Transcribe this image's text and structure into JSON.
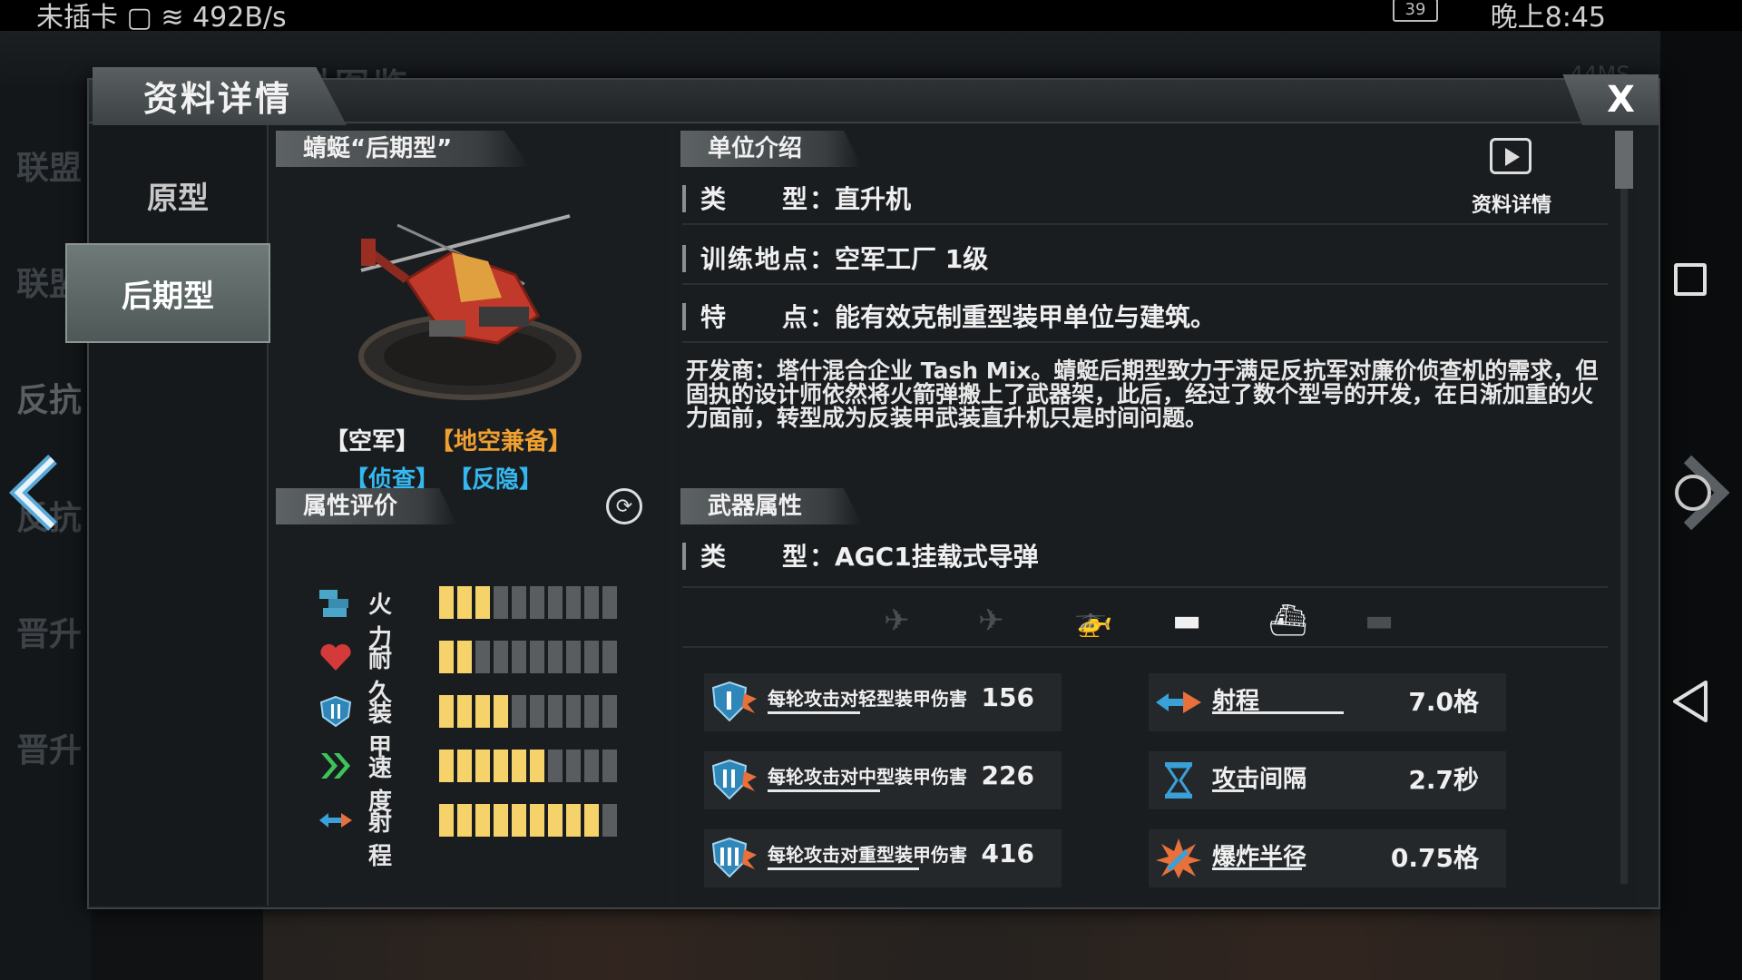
{
  "status_bar": {
    "carrier": "未插卡",
    "speed": "492B/s",
    "battery": "39",
    "time": "晚上8:45"
  },
  "background": {
    "title": "资料图鉴",
    "ping": "44MS",
    "left_items": [
      "联盟",
      "联盟",
      "反抗",
      "反抗",
      "晋升",
      "晋升"
    ]
  },
  "dialog": {
    "title": "资料详情",
    "close_label": "X",
    "variants": [
      "原型",
      "后期型"
    ],
    "active_variant": "后期型"
  },
  "unit": {
    "name": "蜻蜓“后期型”",
    "tags": [
      {
        "text": "【空军】",
        "color": "#f0f0f0"
      },
      {
        "text": "【地空兼备】",
        "color": "#f0a030"
      },
      {
        "text": "【侦查】",
        "color": "#35b8f0"
      },
      {
        "text": "【反隐】",
        "color": "#35b8f0"
      }
    ]
  },
  "attributes": {
    "header": "属性评价",
    "stats": [
      {
        "icon": "firepower-icon",
        "label": "火力",
        "level": 3,
        "max": 10
      },
      {
        "icon": "heart-icon",
        "label": "耐久",
        "level": 2,
        "max": 10
      },
      {
        "icon": "shield-icon",
        "label": "装甲",
        "level": 4,
        "max": 10
      },
      {
        "icon": "speed-chevron-icon",
        "label": "速度",
        "level": 6,
        "max": 10
      },
      {
        "icon": "range-arrow-icon",
        "label": "射程",
        "level": 9,
        "max": 10
      }
    ]
  },
  "intro": {
    "header": "单位介绍",
    "detail_label": "资料详情",
    "rows": [
      {
        "key": "类　　型：",
        "value": "直升机"
      },
      {
        "key": "训练地点：",
        "value": "空军工厂 1级"
      },
      {
        "key": "特　　点：",
        "value": "能有效克制重型装甲单位与建筑。"
      }
    ],
    "description": "开发商：塔什混合企业 Tash Mix。蜻蜓后期型致力于满足反抗军对廉价侦查机的需求，但固执的设计师依然将火箭弹搬上了武器架，此后，经过了数个型号的开发，在日渐加重的火力面前，转型成为反装甲武装直升机只是时间问题。"
  },
  "weapon": {
    "header": "武器属性",
    "type_key": "类　　型：",
    "type_value": "AGC1挂载式导弹",
    "targets": [
      {
        "icon": "fighter-jet-icon",
        "symbol": "✈",
        "active": false
      },
      {
        "icon": "bomber-icon",
        "symbol": "✈",
        "active": false
      },
      {
        "icon": "helicopter-icon",
        "symbol": "🚁",
        "active": true
      },
      {
        "icon": "tank-icon",
        "symbol": "▬",
        "active": true
      },
      {
        "icon": "ship-icon",
        "symbol": "⛴",
        "active": true
      },
      {
        "icon": "submarine-icon",
        "symbol": "▬",
        "active": false
      }
    ],
    "damage": [
      {
        "icon": "shield-one-icon",
        "label": "每轮攻击对轻型装甲伤害",
        "value": "156",
        "fill": 0.6
      },
      {
        "icon": "shield-two-icon",
        "label": "每轮攻击对中型装甲伤害",
        "value": "226",
        "fill": 0.73
      },
      {
        "icon": "shield-three-icon",
        "label": "每轮攻击对重型装甲伤害",
        "value": "416",
        "fill": 0.98
      }
    ],
    "properties": [
      {
        "icon": "range-arrow-icon",
        "label": "射程",
        "value": "7.0格",
        "fill": 0.5
      },
      {
        "icon": "hourglass-icon",
        "label": "攻击间隔",
        "value": "2.7秒",
        "fill": 0.12
      },
      {
        "icon": "explosion-icon",
        "label": "爆炸半径",
        "value": "0.75格",
        "fill": 0.34
      }
    ]
  }
}
